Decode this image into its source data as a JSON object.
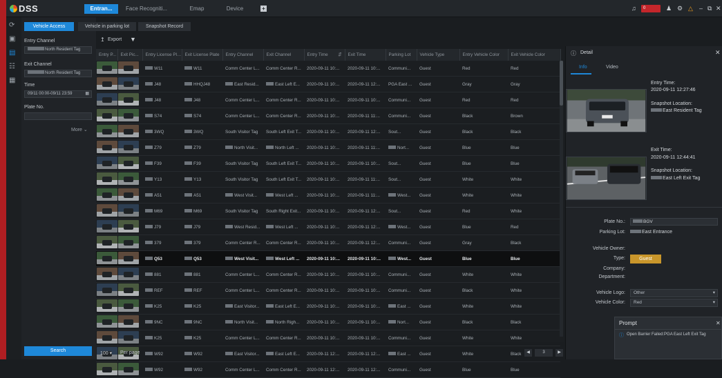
{
  "app": {
    "name": "DSS",
    "alarm_count": "0"
  },
  "top_tabs": [
    "Entran...",
    "Face Recogniti...",
    "Emap",
    "Device"
  ],
  "sub_tabs": [
    "Vehicle Access",
    "Vehicle in parking lot",
    "Snapshot Record"
  ],
  "filters": {
    "entry_channel_label": "Entry Channel",
    "entry_channel_value": "North Resident Tag",
    "exit_channel_label": "Exit Channel",
    "exit_channel_value": "North Resident Tag",
    "time_label": "Time",
    "time_value": "09/11 00:00-09/11 23:59",
    "plate_label": "Plate No.",
    "plate_value": "",
    "more_label": "More",
    "search_label": "Search"
  },
  "toolbar": {
    "export_label": "Export"
  },
  "table": {
    "columns": [
      "Entry P...",
      "Exit Pic...",
      "Entry License Plate",
      "Exit License Plate",
      "Entry Channel",
      "Exit Channel",
      "Entry Time",
      "Exit Time",
      "Parking Lot",
      "Vehicle Type",
      "Entry Vehicle Color",
      "Exit Vehicle Color"
    ],
    "rows": [
      [
        "W11",
        "W11",
        "Comm Center L...",
        "Comm Center R...",
        "2020-09-11 10:...",
        "2020-09-11 10:...",
        "Communi...",
        "Guest",
        "Red",
        "Red"
      ],
      [
        "J48",
        "HHQJ48",
        "East Resid...",
        "East Left E...",
        "2020-09-11 10:...",
        "2020-09-11 12:...",
        "PGA East ...",
        "Guest",
        "Gray",
        "Gray"
      ],
      [
        "J48",
        "J48",
        "Comm Center L...",
        "Comm Center R...",
        "2020-09-11 10:...",
        "2020-09-11 10:...",
        "Communi...",
        "Guest",
        "Red",
        "Red"
      ],
      [
        "S74",
        "S74",
        "Comm Center L...",
        "Comm Center R...",
        "2020-09-11 10:...",
        "2020-09-11 11:...",
        "Communi...",
        "Guest",
        "Black",
        "Brown"
      ],
      [
        "3WQ",
        "3WQ",
        "South Visitor Tag",
        "South Left Exit T...",
        "2020-09-11 10:...",
        "2020-09-11 12:...",
        "Sout...",
        "Guest",
        "Black",
        "Black"
      ],
      [
        "Z79",
        "Z79",
        "North Visit...",
        "North Left ...",
        "2020-09-11 10:...",
        "2020-09-11 11:...",
        "Nort...",
        "Guest",
        "Blue",
        "Blue"
      ],
      [
        "F39",
        "F39",
        "South Visitor Tag",
        "South Left Exit T...",
        "2020-09-11 10:...",
        "2020-09-11 10:...",
        "Sout...",
        "Guest",
        "Blue",
        "Blue"
      ],
      [
        "Y13",
        "Y13",
        "South Visitor Tag",
        "South Left Exit T...",
        "2020-09-11 10:...",
        "2020-09-11 11:...",
        "Sout...",
        "Guest",
        "White",
        "White"
      ],
      [
        "A51",
        "A51",
        "West Visit...",
        "West Left ...",
        "2020-09-11 10:...",
        "2020-09-11 11:...",
        "West...",
        "Guest",
        "White",
        "White"
      ],
      [
        "M69",
        "M69",
        "South Visitor Tag",
        "South Right Exit...",
        "2020-09-11 10:...",
        "2020-09-11 12:...",
        "Sout...",
        "Guest",
        "Red",
        "White"
      ],
      [
        "J79",
        "J79",
        "West Resid...",
        "West Left ...",
        "2020-09-11 10:...",
        "2020-09-11 12:...",
        "West...",
        "Guest",
        "Blue",
        "Red"
      ],
      [
        "379",
        "379",
        "Comm Center R...",
        "Comm Center R...",
        "2020-09-11 10:...",
        "2020-09-11 12:...",
        "Communi...",
        "Guest",
        "Gray",
        "Black"
      ],
      [
        "Q53",
        "Q53",
        "West Visit...",
        "West Left ...",
        "2020-09-11 10:...",
        "2020-09-11 10:...",
        "West...",
        "Guest",
        "Blue",
        "Blue"
      ],
      [
        "881",
        "881",
        "Comm Center L...",
        "Comm Center R...",
        "2020-09-11 10:...",
        "2020-09-11 10:...",
        "Communi...",
        "Guest",
        "White",
        "White"
      ],
      [
        "REF",
        "REF",
        "Comm Center L...",
        "Comm Center R...",
        "2020-09-11 10:...",
        "2020-09-11 10:...",
        "Communi...",
        "Guest",
        "Black",
        "White"
      ],
      [
        "K25",
        "K25",
        "East Visitor...",
        "East Left E...",
        "2020-09-11 10:...",
        "2020-09-11 10:...",
        "East ...",
        "Guest",
        "White",
        "White"
      ],
      [
        "9NC",
        "9NC",
        "North Visit...",
        "North Righ...",
        "2020-09-11 10:...",
        "2020-09-11 10:...",
        "Nort...",
        "Guest",
        "Black",
        "Black"
      ],
      [
        "K25",
        "K25",
        "Comm Center L...",
        "Comm Center R...",
        "2020-09-11 10:...",
        "2020-09-11 10:...",
        "Communi...",
        "Guest",
        "White",
        "White"
      ],
      [
        "W92",
        "W92",
        "East Visitor...",
        "East Left E...",
        "2020-09-11 12:...",
        "2020-09-11 12:...",
        "East ...",
        "Guest",
        "White",
        "Black"
      ],
      [
        "W92",
        "W92",
        "Comm Center L...",
        "Comm Center R...",
        "2020-09-11 12:...",
        "2020-09-11 12:...",
        "Communi...",
        "Guest",
        "Blue",
        "Blue"
      ]
    ]
  },
  "footer": {
    "per_page_value": "100",
    "per_page_label": "Per page",
    "page": "3"
  },
  "detail": {
    "title": "Detail",
    "tabs": [
      "Info",
      "Video"
    ],
    "entry_time_label": "Entry Time:",
    "entry_time": "2020-09-11 12:27:46",
    "entry_snapshot_label": "Snapshot Location:",
    "entry_snapshot": "East Resident Tag",
    "exit_time_label": "Exit Time:",
    "exit_time": "2020-09-11 12:44:41",
    "exit_snapshot_label": "Snapshot Location:",
    "exit_snapshot": "East Left Exit Tag",
    "plate_label": "Plate No.:",
    "plate_value": "BGV",
    "parking_label": "Parking Lot:",
    "parking_value": "East Entrance",
    "owner_label": "Vehicle Owner:",
    "type_label": "Type:",
    "type_value": "Guest",
    "company_label": "Company:",
    "department_label": "Department:",
    "logo_label": "Vehicle Logo:",
    "logo_value": "Other",
    "color_label": "Vehicle Color:",
    "color_value": "Red"
  },
  "prompt": {
    "title": "Prompt",
    "message": "Open Barrier Failed:PGA East Left Exit Tag"
  },
  "colors": {
    "accent": "#1e88d9",
    "alarm": "#c4262b",
    "guest_badge": "#c9962b",
    "brand_red": "#b01e22"
  }
}
